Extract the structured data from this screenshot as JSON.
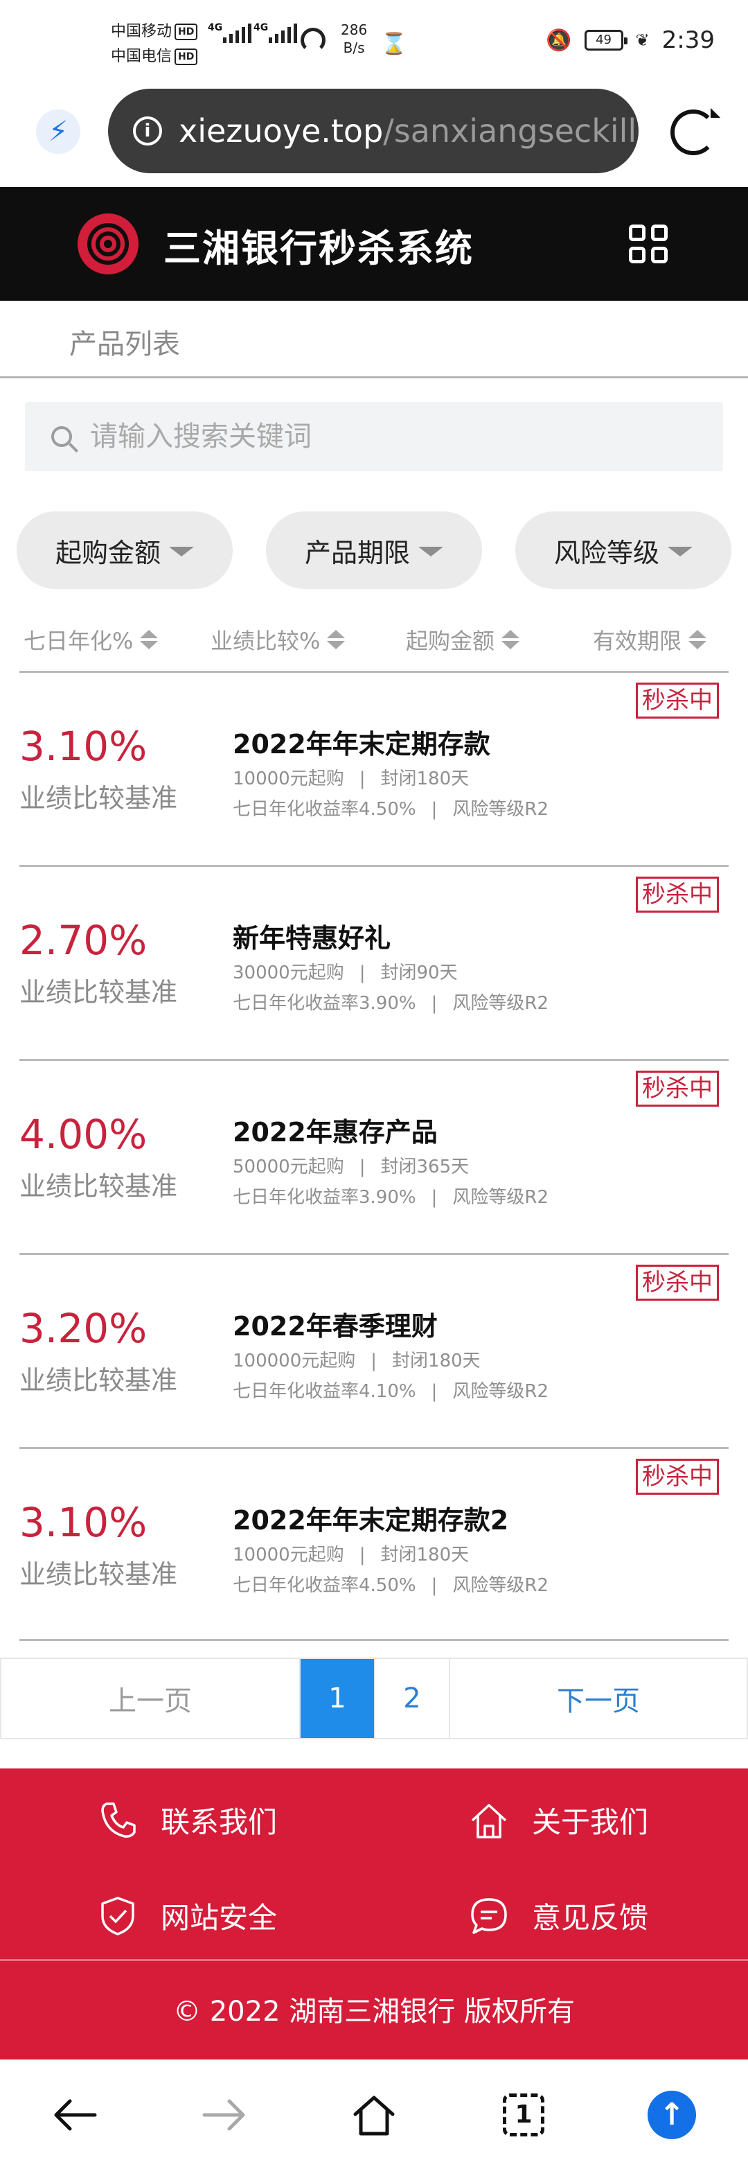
{
  "status_bar": {
    "carrier1": "中国移动",
    "carrier2": "中国电信",
    "hd_label": "HD",
    "net_type": "4G",
    "net_speed_value": "286",
    "net_speed_unit": "B/s",
    "battery": "49",
    "time": "2:39"
  },
  "browser": {
    "url_domain": "xiezuoye.top",
    "url_path": "/sanxiangseckilln"
  },
  "header": {
    "title": "三湘银行秒杀系统"
  },
  "breadcrumb": {
    "tab_label": "产品列表"
  },
  "search": {
    "placeholder": "请输入搜索关键词"
  },
  "filters": [
    {
      "label": "起购金额"
    },
    {
      "label": "产品期限"
    },
    {
      "label": "风险等级"
    }
  ],
  "sort": [
    {
      "label": "七日年化%"
    },
    {
      "label": "业绩比较%"
    },
    {
      "label": "起购金额"
    },
    {
      "label": "有效期限"
    }
  ],
  "products": [
    {
      "badge": "秒杀中",
      "rate": "3.10%",
      "rate_label": "业绩比较基准",
      "name": "2022年年末定期存款",
      "min_amount": "10000元起购",
      "term": "封闭180天",
      "seven_day": "七日年化收益率4.50%",
      "risk": "风险等级R2"
    },
    {
      "badge": "秒杀中",
      "rate": "2.70%",
      "rate_label": "业绩比较基准",
      "name": "新年特惠好礼",
      "min_amount": "30000元起购",
      "term": "封闭90天",
      "seven_day": "七日年化收益率3.90%",
      "risk": "风险等级R2"
    },
    {
      "badge": "秒杀中",
      "rate": "4.00%",
      "rate_label": "业绩比较基准",
      "name": "2022年惠存产品",
      "min_amount": "50000元起购",
      "term": "封闭365天",
      "seven_day": "七日年化收益率3.90%",
      "risk": "风险等级R2"
    },
    {
      "badge": "秒杀中",
      "rate": "3.20%",
      "rate_label": "业绩比较基准",
      "name": "2022年春季理财",
      "min_amount": "100000元起购",
      "term": "封闭180天",
      "seven_day": "七日年化收益率4.10%",
      "risk": "风险等级R2"
    },
    {
      "badge": "秒杀中",
      "rate": "3.10%",
      "rate_label": "业绩比较基准",
      "name": "2022年年末定期存款2",
      "min_amount": "10000元起购",
      "term": "封闭180天",
      "seven_day": "七日年化收益率4.50%",
      "risk": "风险等级R2"
    }
  ],
  "pagination": {
    "prev": "上一页",
    "pages": [
      "1",
      "2"
    ],
    "current": "1",
    "next": "下一页"
  },
  "footer": {
    "contact": "联系我们",
    "about": "关于我们",
    "security": "网站安全",
    "feedback": "意见反馈",
    "copyright": "© 2022 湖南三湘银行 版权所有"
  },
  "bottom_nav": {
    "tab_count": "1"
  },
  "colors": {
    "brand_red": "#d61c38",
    "header_black": "#0e0e0e",
    "page_active_blue": "#1e8ce8",
    "rate_red": "#c8233d"
  }
}
